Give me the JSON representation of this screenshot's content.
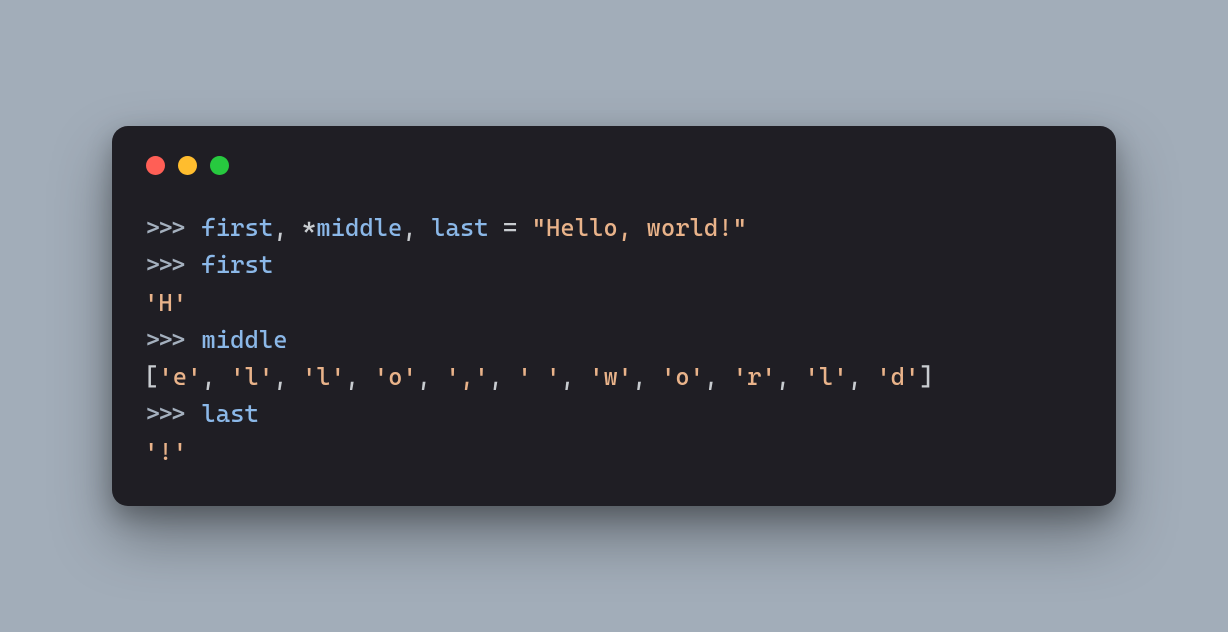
{
  "window": {
    "traffic_lights": [
      "red",
      "yellow",
      "green"
    ]
  },
  "code": {
    "prompt": ">>> ",
    "line1": {
      "var1": "first",
      "comma1": ", ",
      "star": "*",
      "var2": "middle",
      "comma2": ", ",
      "var3": "last",
      "assign": " = ",
      "str": "\"Hello, world!\""
    },
    "line2": {
      "expr": "first"
    },
    "out2": "'H'",
    "line3": {
      "expr": "middle"
    },
    "out3": {
      "open": "[",
      "items": [
        "'e'",
        "'l'",
        "'l'",
        "'o'",
        "','",
        "' '",
        "'w'",
        "'o'",
        "'r'",
        "'l'",
        "'d'"
      ],
      "sep": ", ",
      "close": "]"
    },
    "line4": {
      "expr": "last"
    },
    "out4": "'!'"
  }
}
